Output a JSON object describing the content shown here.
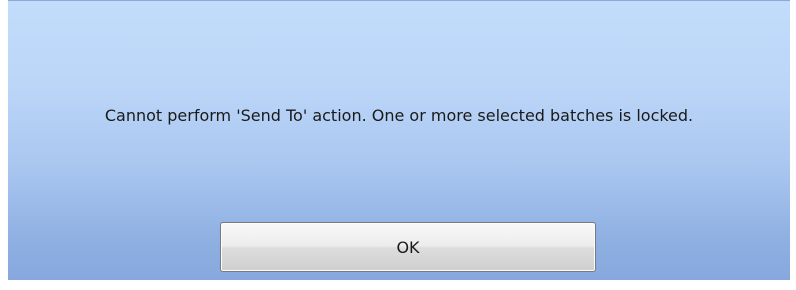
{
  "dialog": {
    "message": "Cannot perform 'Send To' action. One or more selected batches is locked.",
    "ok_label": "OK"
  },
  "colors": {
    "background_top": "#c2dcfb",
    "background_bottom": "#86a8de",
    "button_face": "#ececec",
    "button_border": "#7a7a7a",
    "text": "#1a1a1a"
  }
}
